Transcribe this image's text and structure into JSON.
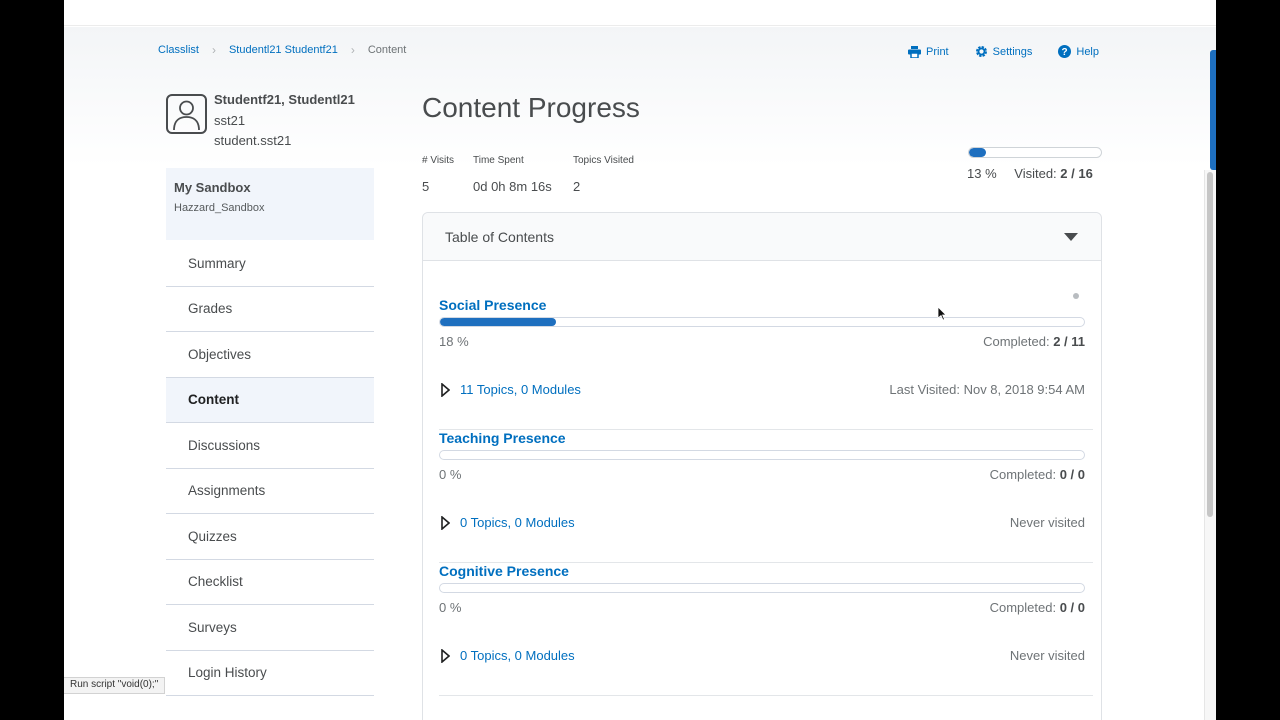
{
  "breadcrumbs": [
    "Classlist",
    "Studentl21 Studentf21",
    "Content"
  ],
  "toplinks": {
    "print": "Print",
    "settings": "Settings",
    "help": "Help"
  },
  "profile": {
    "name": "Studentf21, Studentl21",
    "username": "sst21",
    "email": "student.sst21"
  },
  "org": {
    "title": "My Sandbox",
    "subtitle": "Hazzard_Sandbox"
  },
  "nav": [
    {
      "label": "Summary",
      "active": false
    },
    {
      "label": "Grades",
      "active": false
    },
    {
      "label": "Objectives",
      "active": false
    },
    {
      "label": "Content",
      "active": true
    },
    {
      "label": "Discussions",
      "active": false
    },
    {
      "label": "Assignments",
      "active": false
    },
    {
      "label": "Quizzes",
      "active": false
    },
    {
      "label": "Checklist",
      "active": false
    },
    {
      "label": "Surveys",
      "active": false
    },
    {
      "label": "Login History",
      "active": false
    }
  ],
  "page_title": "Content Progress",
  "stats": {
    "visits_label": "# Visits",
    "visits_value": "5",
    "time_label": "Time Spent",
    "time_value": "0d 0h 8m 16s",
    "topics_label": "Topics Visited",
    "topics_value": "2"
  },
  "overall": {
    "percent_text": "13 %",
    "visited_label": "Visited:",
    "visited_value": "2 / 16",
    "progress": 0.13
  },
  "toc": {
    "title": "Table of Contents",
    "modules": [
      {
        "title": "Social Presence",
        "progress": 0.18,
        "percent_text": "18 %",
        "completed_label": "Completed:",
        "completed_value": "2 / 11",
        "topics": "11 Topics, 0 Modules",
        "visited": "Last Visited: Nov 8, 2018 9:54 AM"
      },
      {
        "title": "Teaching Presence",
        "progress": 0,
        "percent_text": "0 %",
        "completed_label": "Completed:",
        "completed_value": "0 / 0",
        "topics": "0 Topics, 0 Modules",
        "visited": "Never visited"
      },
      {
        "title": "Cognitive Presence",
        "progress": 0,
        "percent_text": "0 %",
        "completed_label": "Completed:",
        "completed_value": "0 / 0",
        "topics": "0 Topics, 0 Modules",
        "visited": "Never visited"
      }
    ]
  },
  "statusbar": "Run script \"void(0);\"",
  "colors": {
    "link": "#006fbf",
    "accent": "#1e6fbf",
    "active_bg": "#f1f5fb"
  }
}
